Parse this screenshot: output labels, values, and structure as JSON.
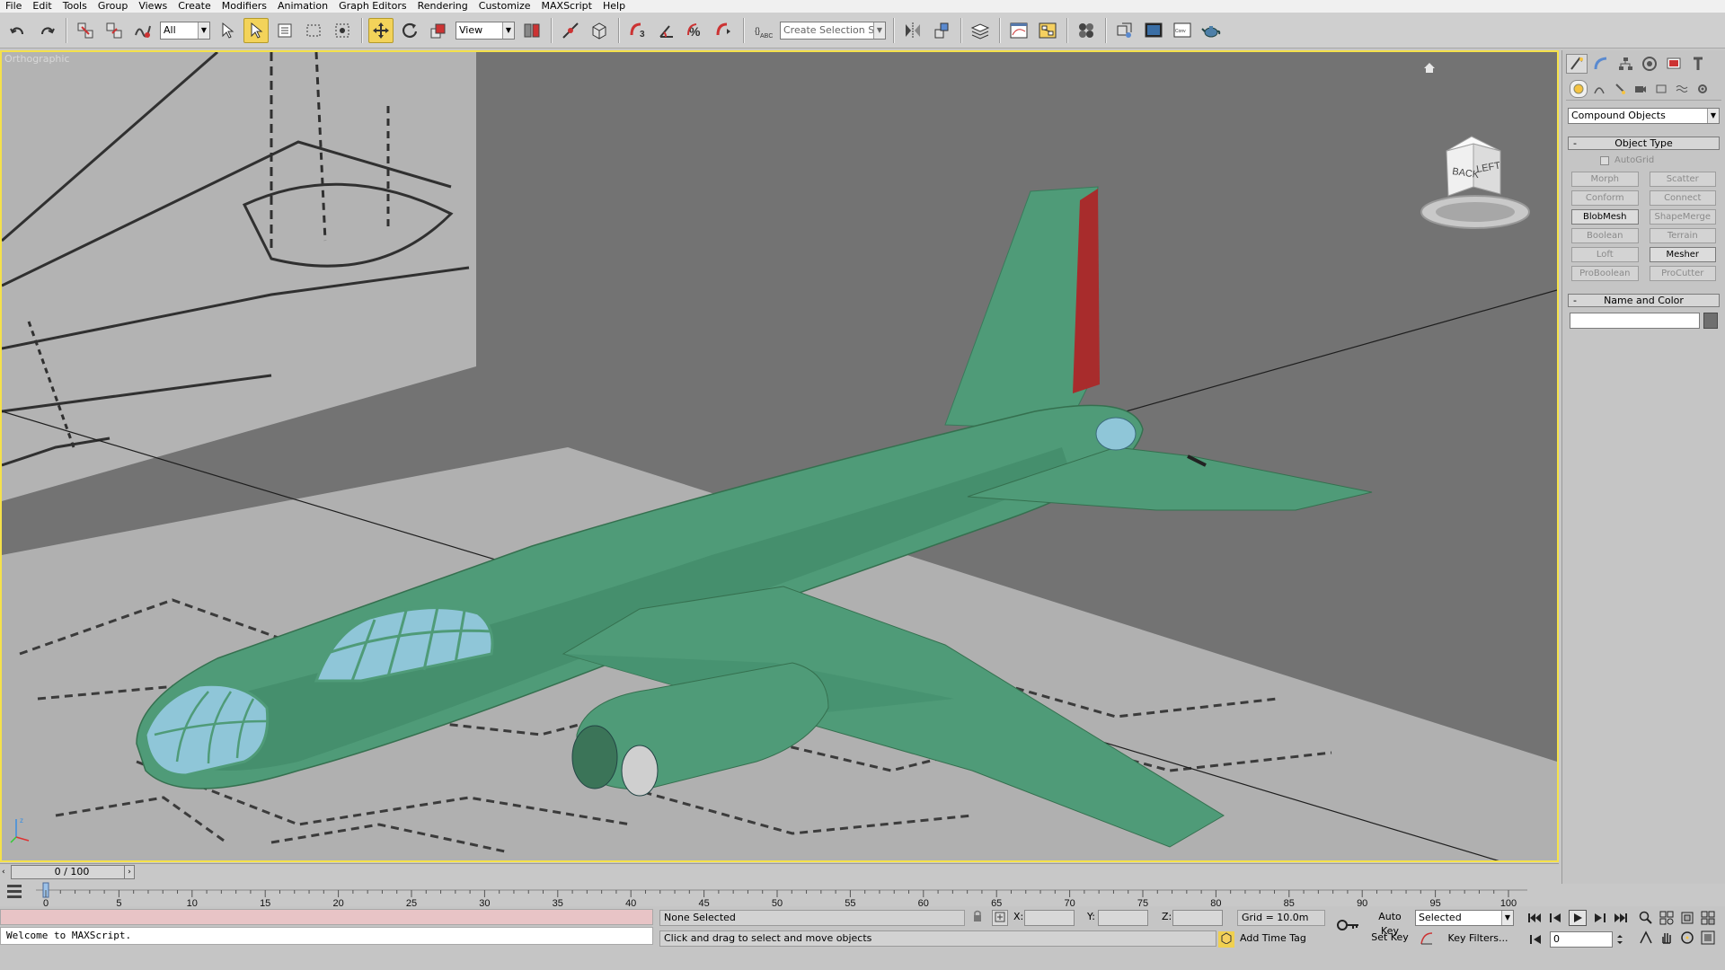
{
  "menu": [
    "File",
    "Edit",
    "Tools",
    "Group",
    "Views",
    "Create",
    "Modifiers",
    "Animation",
    "Graph Editors",
    "Rendering",
    "Customize",
    "MAXScript",
    "Help"
  ],
  "toolbar": {
    "selection_filter": "All",
    "ref_coord": "View",
    "named_selection_placeholder": "Create Selection Set"
  },
  "viewport": {
    "label": "Orthographic",
    "viewcube_faces": [
      "BACK",
      "LEFT"
    ]
  },
  "command_panel": {
    "category": "Compound Objects",
    "object_type": {
      "title": "Object Type",
      "autogrid_label": "AutoGrid",
      "buttons": [
        {
          "label": "Morph",
          "enabled": false
        },
        {
          "label": "Scatter",
          "enabled": false
        },
        {
          "label": "Conform",
          "enabled": false
        },
        {
          "label": "Connect",
          "enabled": false
        },
        {
          "label": "BlobMesh",
          "enabled": true
        },
        {
          "label": "ShapeMerge",
          "enabled": false
        },
        {
          "label": "Boolean",
          "enabled": false
        },
        {
          "label": "Terrain",
          "enabled": false
        },
        {
          "label": "Loft",
          "enabled": false
        },
        {
          "label": "Mesher",
          "enabled": true
        },
        {
          "label": "ProBoolean",
          "enabled": false
        },
        {
          "label": "ProCutter",
          "enabled": false
        }
      ]
    },
    "name_color": {
      "title": "Name and Color",
      "name_value": "",
      "color": "#6f6f6f"
    }
  },
  "timeline": {
    "frame_display": "0 / 100",
    "ticks": [
      0,
      5,
      10,
      15,
      20,
      25,
      30,
      35,
      40,
      45,
      50,
      55,
      60,
      65,
      70,
      75,
      80,
      85,
      90,
      95,
      100
    ]
  },
  "status": {
    "maxscript_text": "Welcome to MAXScript.",
    "selection": "None Selected",
    "prompt": "Click and drag to select and move objects",
    "x_label": "X:",
    "y_label": "Y:",
    "z_label": "Z:",
    "grid": "Grid = 10.0m",
    "add_time_tag": "Add Time Tag",
    "auto_key": "Auto Key",
    "set_key": "Set Key",
    "key_mode": "Selected",
    "key_filters": "Key Filters...",
    "current_frame": "0"
  },
  "colors": {
    "viewport_border": "#f5e14a",
    "plane_body": "#4f9b78",
    "plane_canopy": "#8fc6d8",
    "plane_tail_stripe": "#a82c2c"
  }
}
